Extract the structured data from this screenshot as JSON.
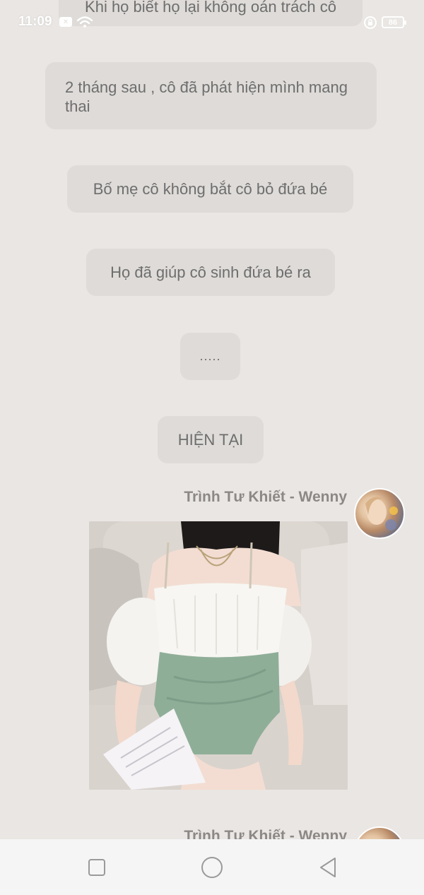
{
  "status_bar": {
    "time": "11:09",
    "battery": "86",
    "icons": [
      "x-notification-icon",
      "wifi-icon",
      "rotation-lock-icon",
      "battery-icon"
    ]
  },
  "messages": [
    {
      "text": "Khi họ biết họ lại không oán trách cô"
    },
    {
      "text": "2 tháng sau , cô đã phát hiện mình mang thai"
    },
    {
      "text": "Bố mẹ cô không bắt cô bỏ đứa bé"
    },
    {
      "text": "Họ đã giúp cô sinh đứa bé ra"
    },
    {
      "text": "....."
    },
    {
      "text": "HIỆN TẠI"
    }
  ],
  "sender": {
    "name": "Trình Tư Khiết - Wenny",
    "name_repeat": "Trình Tư Khiết - Wenny"
  },
  "navigation": {
    "icons": [
      "recent-apps-icon",
      "home-icon",
      "back-icon"
    ]
  },
  "colors": {
    "background": "#e9e6e3",
    "bubble": "#dedbd8",
    "bubble_text": "#6e6e6e",
    "sender_text": "#8b8886",
    "nav_bar": "#f5f5f5"
  }
}
